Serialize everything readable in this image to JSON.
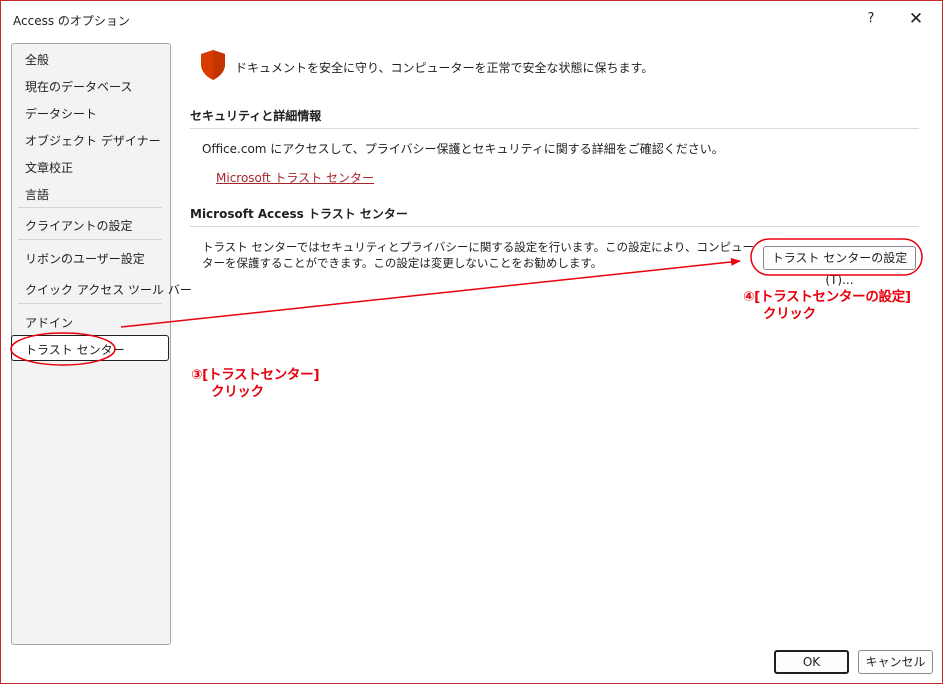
{
  "window": {
    "title": "Access のオプション",
    "help": "?",
    "close": "✕"
  },
  "sidebar": {
    "items": [
      {
        "label": "全般"
      },
      {
        "label": "現在のデータベース"
      },
      {
        "label": "データシート"
      },
      {
        "label": "オブジェクト デザイナー"
      },
      {
        "label": "文章校正"
      },
      {
        "label": "言語"
      },
      {
        "label": "クライアントの設定"
      },
      {
        "label": "リボンのユーザー設定"
      },
      {
        "label": "クイック アクセス ツール バー"
      },
      {
        "label": "アドイン"
      },
      {
        "label": "トラスト センター"
      }
    ],
    "selected_index": 10
  },
  "main": {
    "intro": "ドキュメントを安全に守り、コンピューターを正常で安全な状態に保ちます。",
    "security_section": {
      "title": "セキュリティと詳細情報",
      "text": "Office.com にアクセスして、プライバシー保護とセキュリティに関する詳細をご確認ください。",
      "link": "Microsoft トラスト センター"
    },
    "trust_section": {
      "title": "Microsoft Access トラスト センター",
      "description": "トラスト センターではセキュリティとプライバシーに関する設定を行います。この設定により、コンピューターを保護することができます。この設定は変更しないことをお勧めします。",
      "button": "トラスト センターの設定(T)..."
    }
  },
  "footer": {
    "ok": "OK",
    "cancel": "キャンセル"
  },
  "annotations": {
    "step3": {
      "line1": "③[トラストセンター]",
      "line2": "クリック"
    },
    "step4": {
      "line1": "④[トラストセンターの設定]",
      "line2": "クリック"
    }
  },
  "colors": {
    "annotation": "#e8000d",
    "shield": "#d83b01",
    "link": "#a4262c"
  },
  "icons": {
    "shield": "shield-icon",
    "close": "close-icon",
    "help": "help-icon"
  }
}
